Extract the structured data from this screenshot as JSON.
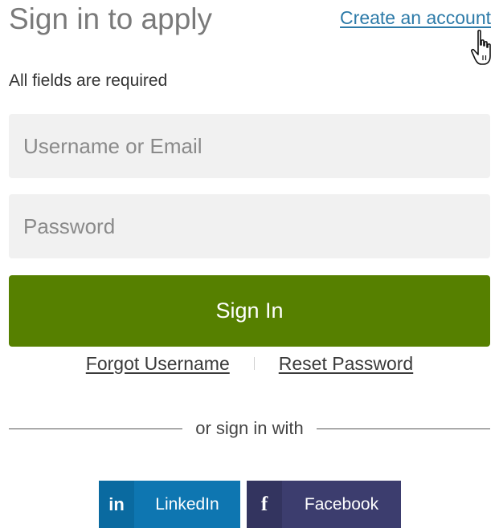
{
  "header": {
    "title": "Sign in to apply",
    "create_account_link": "Create an account"
  },
  "form": {
    "required_note": "All fields are required",
    "username_placeholder": "Username or Email",
    "username_value": "",
    "password_placeholder": "Password",
    "password_value": "",
    "sign_in_label": "Sign In"
  },
  "links": {
    "forgot_username": "Forgot Username",
    "reset_password": "Reset Password"
  },
  "social": {
    "divider_text": "or sign in with",
    "linkedin": {
      "icon_text": "in",
      "label": "LinkedIn",
      "icon": "linkedin-icon"
    },
    "facebook": {
      "icon_text": "f",
      "label": "Facebook",
      "icon": "facebook-icon"
    }
  },
  "colors": {
    "primary_green": "#568000",
    "link_blue": "#2c7aa8",
    "linkedin_blue": "#0e76b1",
    "facebook_navy": "#3c3d6e",
    "field_bg": "#f1f1f1"
  }
}
